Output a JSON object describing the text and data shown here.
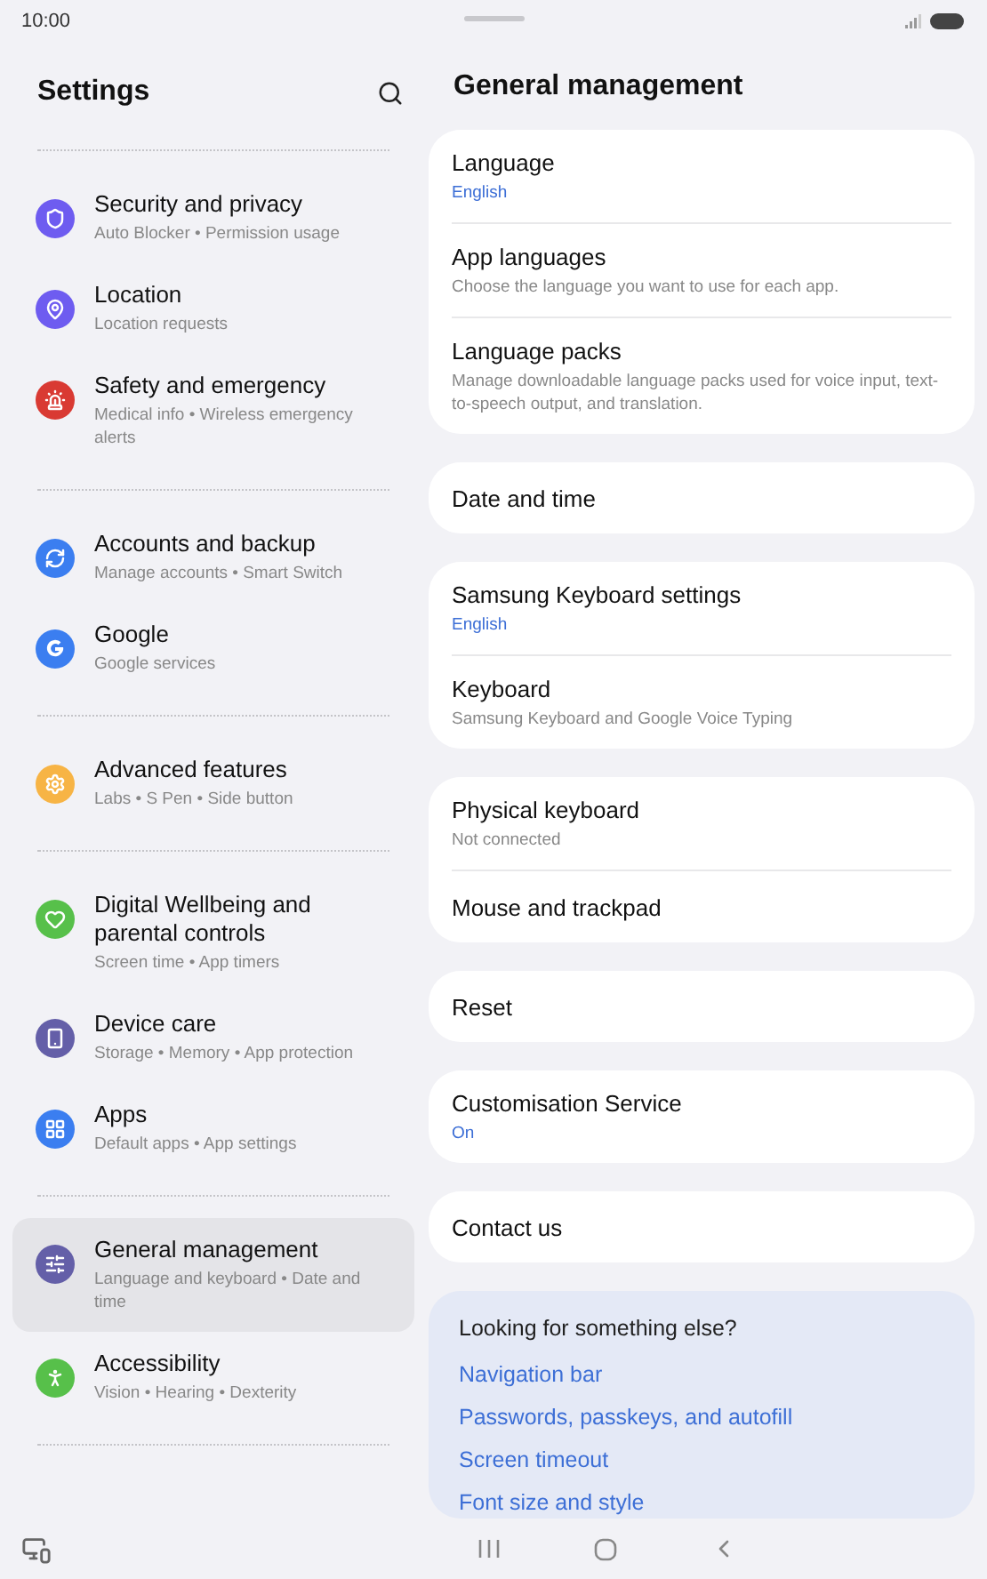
{
  "status_bar": {
    "time": "10:00"
  },
  "sidebar": {
    "title": "Settings",
    "groups": [
      [
        {
          "kind": "shield",
          "color": "#6e5cf0",
          "title": "Security and privacy",
          "subtitle": "Auto Blocker  •  Permission usage",
          "selected": false
        },
        {
          "kind": "pin",
          "color": "#6e5cf0",
          "title": "Location",
          "subtitle": "Location requests",
          "selected": false
        },
        {
          "kind": "siren",
          "color": "#d93a33",
          "title": "Safety and emergency",
          "subtitle": "Medical info  •  Wireless emergency alerts",
          "selected": false
        }
      ],
      [
        {
          "kind": "sync",
          "color": "#3b7ef0",
          "title": "Accounts and backup",
          "subtitle": "Manage accounts  •  Smart Switch",
          "selected": false
        },
        {
          "kind": "g",
          "color": "#3b7ef0",
          "title": "Google",
          "subtitle": "Google services",
          "selected": false
        }
      ],
      [
        {
          "kind": "gear",
          "color": "#f7b445",
          "title": "Advanced features",
          "subtitle": "Labs  •  S Pen  •  Side button",
          "selected": false
        }
      ],
      [
        {
          "kind": "heart",
          "color": "#57c04a",
          "title": "Digital Wellbeing and parental controls",
          "subtitle": "Screen time  •  App timers",
          "selected": false
        },
        {
          "kind": "phone",
          "color": "#645fa8",
          "title": "Device care",
          "subtitle": "Storage  •  Memory  •  App protection",
          "selected": false
        },
        {
          "kind": "grid",
          "color": "#3b7ef0",
          "title": "Apps",
          "subtitle": "Default apps  •  App settings",
          "selected": false
        }
      ],
      [
        {
          "kind": "sliders",
          "color": "#645fa8",
          "title": "General management",
          "subtitle": "Language and keyboard  •  Date and time",
          "selected": true
        },
        {
          "kind": "person",
          "color": "#57c04a",
          "title": "Accessibility",
          "subtitle": "Vision  •  Hearing  •  Dexterity",
          "selected": false
        }
      ]
    ]
  },
  "content": {
    "title": "General management",
    "cards": [
      [
        {
          "title": "Language",
          "subtitle": "English",
          "kind": "value"
        },
        {
          "title": "App languages",
          "subtitle": "Choose the language you want to use for each app.",
          "kind": "hint"
        },
        {
          "title": "Language packs",
          "subtitle": "Manage downloadable language packs used for voice input, text-to-speech output, and translation.",
          "kind": "hint"
        }
      ],
      [
        {
          "title": "Date and time"
        }
      ],
      [
        {
          "title": "Samsung Keyboard settings",
          "subtitle": "English",
          "kind": "value"
        },
        {
          "title": "Keyboard",
          "subtitle": "Samsung Keyboard and Google Voice Typing",
          "kind": "hint"
        }
      ],
      [
        {
          "title": "Physical keyboard",
          "subtitle": "Not connected",
          "kind": "hint"
        },
        {
          "title": "Mouse and trackpad"
        }
      ],
      [
        {
          "title": "Reset"
        }
      ],
      [
        {
          "title": "Customisation Service",
          "subtitle": "On",
          "kind": "value"
        }
      ],
      [
        {
          "title": "Contact us"
        }
      ]
    ],
    "suggestions": {
      "title": "Looking for something else?",
      "links": [
        "Navigation bar",
        "Passwords, passkeys, and autofill",
        "Screen timeout",
        "Font size and style"
      ]
    }
  }
}
